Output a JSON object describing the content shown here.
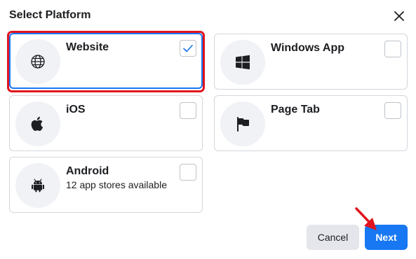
{
  "dialog": {
    "title": "Select Platform"
  },
  "platforms": [
    {
      "name": "Website",
      "subtitle": "",
      "icon": "globe-icon",
      "checked": true
    },
    {
      "name": "Windows App",
      "subtitle": "",
      "icon": "windows-icon",
      "checked": false
    },
    {
      "name": "iOS",
      "subtitle": "",
      "icon": "apple-icon",
      "checked": false
    },
    {
      "name": "Page Tab",
      "subtitle": "",
      "icon": "flag-icon",
      "checked": false
    },
    {
      "name": "Android",
      "subtitle": "12 app stores available",
      "icon": "android-icon",
      "checked": false
    }
  ],
  "buttons": {
    "cancel": "Cancel",
    "next": "Next"
  },
  "colors": {
    "accent": "#1877f2",
    "annotation_red": "#e0141e",
    "card_border": "#d3d6db",
    "icon_bg": "#f0f2f5"
  }
}
